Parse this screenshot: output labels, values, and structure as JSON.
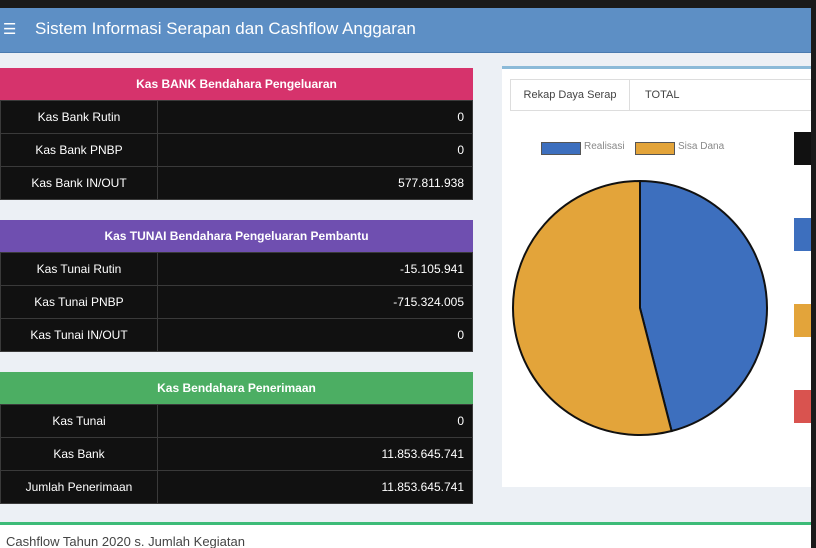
{
  "app": {
    "title": "Sistem Informasi Serapan dan Cashflow Anggaran",
    "menu_icon": "hamburger-icon"
  },
  "colors": {
    "topbar": "#5d8fc5",
    "bank_header": "#d6336c",
    "tunai_header": "#6f4fb0",
    "penerimaan_header": "#4cae63",
    "realisasi": "#3d6fbe",
    "sisa_dana": "#e3a43a"
  },
  "kas_bank": {
    "title": "Kas BANK Bendahara Pengeluaran",
    "rows": [
      {
        "label": "Kas Bank Rutin",
        "value": "0"
      },
      {
        "label": "Kas Bank PNBP",
        "value": "0"
      },
      {
        "label": "Kas Bank IN/OUT",
        "value": "577.811.938"
      }
    ]
  },
  "kas_tunai": {
    "title": "Kas TUNAI Bendahara Pengeluaran Pembantu",
    "rows": [
      {
        "label": "Kas Tunai Rutin",
        "value": "-15.105.941"
      },
      {
        "label": "Kas Tunai PNBP",
        "value": "-715.324.005"
      },
      {
        "label": "Kas Tunai IN/OUT",
        "value": "0"
      }
    ]
  },
  "kas_penerimaan": {
    "title": "Kas Bendahara Penerimaan",
    "rows": [
      {
        "label": "Kas Tunai",
        "value": "0"
      },
      {
        "label": "Kas Bank",
        "value": "11.853.645.741"
      },
      {
        "label": "Jumlah Penerimaan",
        "value": "11.853.645.741"
      }
    ]
  },
  "tabs": {
    "active": "Rekap Daya Serap",
    "second": "TOTAL"
  },
  "chart_data": {
    "type": "pie",
    "labels": [
      "Realisasi",
      "Sisa Dana"
    ],
    "values": [
      46,
      54
    ],
    "colors": [
      "#3d6fbe",
      "#e3a43a"
    ],
    "legend": "top"
  },
  "side_blocks": [
    "#111111",
    "#3d6fbe",
    "#e3a43a",
    "#d9534f"
  ],
  "bottom": {
    "text": "Cashflow Tahun 2020 s. Jumlah Kegiatan"
  }
}
